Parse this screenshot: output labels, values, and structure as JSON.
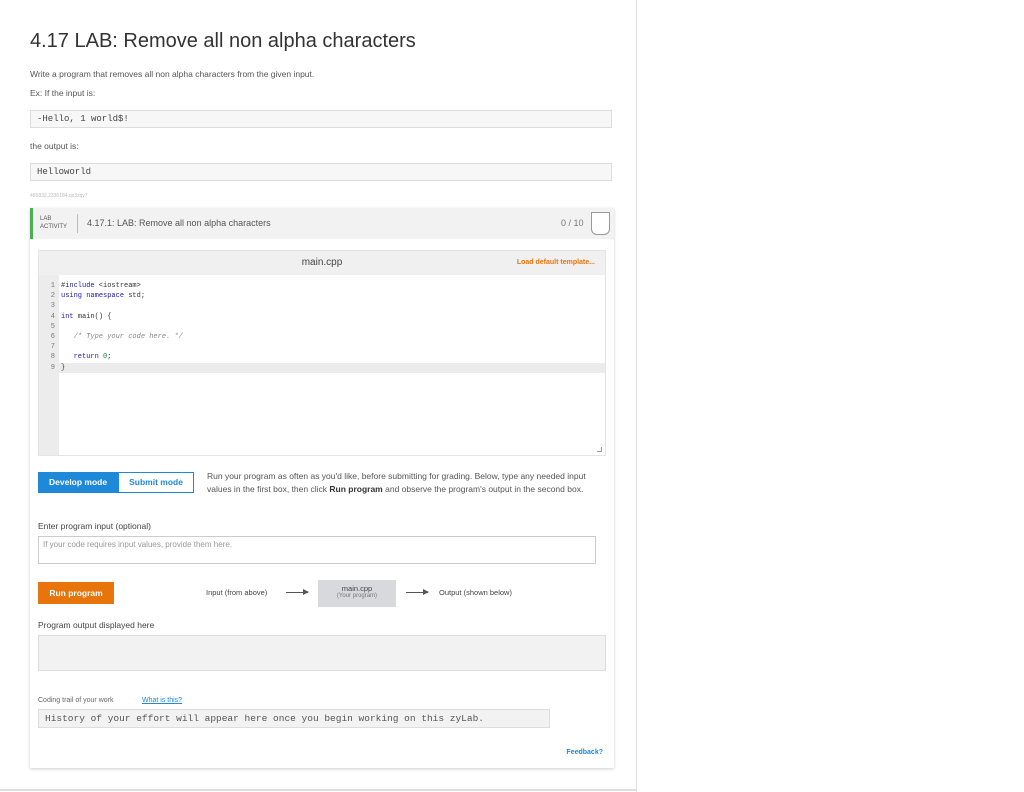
{
  "page": {
    "title": "4.17 LAB: Remove all non alpha characters",
    "description": "Write a program that removes all non alpha characters from the given input.",
    "example_intro": "Ex: If the input is:",
    "example_input": "-Hello, 1 world$!",
    "output_intro": "the output is:",
    "example_output": "Helloworld",
    "tiny_id": "465832.2336184.qx3zqy7"
  },
  "lab": {
    "tag_line1": "LAB",
    "tag_line2": "ACTIVITY",
    "name": "4.17.1: LAB: Remove all non alpha characters",
    "score": "0 / 10"
  },
  "editor": {
    "filename": "main.cpp",
    "load_template": "Load default template...",
    "lines": [
      {
        "n": "1",
        "text": "#include <iostream>"
      },
      {
        "n": "2",
        "text": "using namespace std;"
      },
      {
        "n": "3",
        "text": ""
      },
      {
        "n": "4",
        "text": "int main() {"
      },
      {
        "n": "5",
        "text": ""
      },
      {
        "n": "6",
        "text": "   /* Type your code here. */"
      },
      {
        "n": "7",
        "text": ""
      },
      {
        "n": "8",
        "text": "   return 0;"
      },
      {
        "n": "9",
        "text": "}"
      }
    ],
    "active_line": 9
  },
  "modes": {
    "develop": "Develop mode",
    "submit": "Submit mode",
    "desc_part1": "Run your program as often as you'd like, before submitting for grading. Below, type any needed input values in the first box, then click ",
    "desc_bold": "Run program",
    "desc_part2": " and observe the program's output in the second box."
  },
  "input": {
    "label": "Enter program input (optional)",
    "placeholder": "If your code requires input values, provide them here."
  },
  "run": {
    "button": "Run program",
    "flow_input": "Input (from above)",
    "program_name": "main.cpp",
    "program_sub": "(Your program)",
    "flow_output": "Output (shown below)"
  },
  "output": {
    "label": "Program output displayed here"
  },
  "trail": {
    "label": "Coding trail of your work",
    "link": "What is this?",
    "text": "History of your effort will appear here once you begin working on this zyLab."
  },
  "feedback": "Feedback?"
}
